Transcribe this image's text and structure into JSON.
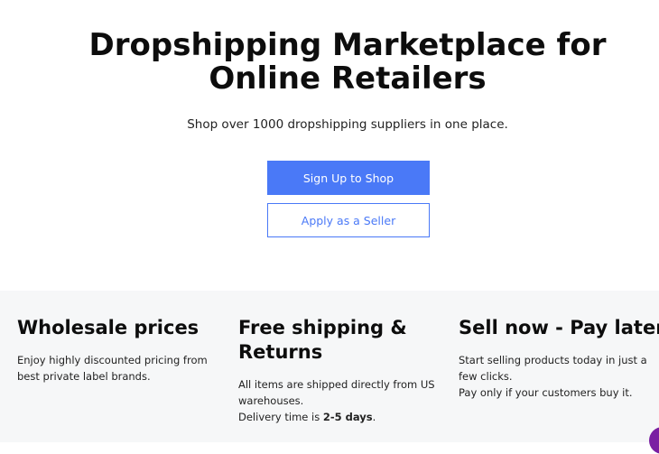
{
  "hero": {
    "title": "Dropshipping Marketplace for Online Retailers",
    "subtitle": "Shop over 1000 dropshipping suppliers in one place.",
    "primary_button": "Sign Up to Shop",
    "secondary_button": "Apply as a Seller"
  },
  "features": [
    {
      "title": "Wholesale prices",
      "lines": [
        "Enjoy highly discounted pricing from best private label brands."
      ]
    },
    {
      "title": "Free shipping & Returns",
      "lines": [
        "All items are shipped directly from US warehouses."
      ],
      "delivery_prefix": "Delivery time is ",
      "delivery_value": "2-5 days",
      "delivery_suffix": "."
    },
    {
      "title": "Sell now - Pay later",
      "lines": [
        "Start selling products today in just a few clicks.",
        "Pay only if your customers buy it."
      ]
    }
  ],
  "colors": {
    "accent": "#4a79f7",
    "features_background": "#f6f7f8",
    "chat_widget": "#7a1fa2"
  },
  "icons": {
    "chat_widget": "chat-bubble-icon"
  }
}
